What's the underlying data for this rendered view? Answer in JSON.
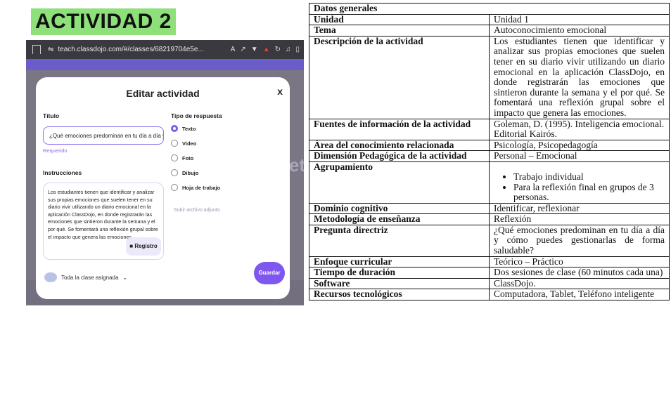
{
  "activity_title": "ACTIVIDAD 2",
  "browser": {
    "url": "teach.classdojo.com/#/classes/68219704e5e..."
  },
  "modal": {
    "title": "Editar actividad",
    "close": "x",
    "titulo_label": "Título",
    "titulo_value": "¿Qué emociones predominan en tu día a día y cómo p",
    "required": "Requerido",
    "instrucciones_label": "Instrucciones",
    "instrucciones_text": "Los estudiantes tienen que identificar y analizar sus propias emociones que suelen tener en su diario vivir utilizando un diario emocional en la aplicación ClassDojo, en donde registrarán las emociones que sintieron durante la semana y el por qué. Se fomentará una reflexión grupal sobre el impacto que genera las emociones.",
    "registro_button": "Registro",
    "assign": "Toda la clase asignada",
    "tipo_label": "Tipo de respuesta",
    "options": [
      "Texto",
      "Video",
      "Foto",
      "Dibujo",
      "Hoja de trabajo"
    ],
    "selected_option": "Texto",
    "attach": "Subir archivo adjunto",
    "save_button": "Guardar",
    "accent_color": "#7e57f0"
  },
  "table": {
    "header": "Datos generales",
    "rows": [
      {
        "key": "Unidad",
        "value": "Unidad 1"
      },
      {
        "key": "Tema",
        "value": "Autoconocimiento emocional"
      },
      {
        "key": "Descripción de la actividad",
        "value": "Los estudiantes tienen que identificar y analizar sus propias emociones que suelen tener en su diario vivir utilizando un diario emocional en la aplicación ClassDojo, en donde registrarán las emociones que sintieron durante la semana y el por qué. Se fomentará una reflexión grupal sobre el impacto que genera las emociones."
      },
      {
        "key": "Fuentes de información de la actividad",
        "value": "Goleman, D. (1995). Inteligencia emocional. Editorial Kairós."
      },
      {
        "key": "Área del conocimiento relacionada",
        "value": "Psicología, Psicopedagogía"
      },
      {
        "key": "Dimensión Pedagógica de la actividad",
        "value": "Personal – Emocional"
      },
      {
        "key": "Agrupamiento",
        "items": [
          "Trabajo individual",
          "Para la reflexión final en grupos de 3 personas."
        ]
      },
      {
        "key": "Dominio cognitivo",
        "value": "Identificar, reflexionar"
      },
      {
        "key": "Metodología de enseñanza",
        "value": "Reflexión"
      },
      {
        "key": "Pregunta directriz",
        "value": "¿Qué emociones predominan en tu día a día y cómo puedes gestionarlas de forma saludable?"
      },
      {
        "key": "Enfoque curricular",
        "value": "Teórico – Práctico"
      },
      {
        "key": "Tiempo de duración",
        "value": "Dos sesiones de clase (60 minutos cada una)"
      },
      {
        "key": "Software",
        "value": "ClassDojo."
      },
      {
        "key": "Recursos tecnológicos",
        "value": "Computadora, Tablet, Teléfono inteligente"
      }
    ]
  }
}
